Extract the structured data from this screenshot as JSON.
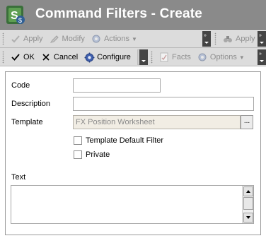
{
  "window": {
    "title": "Command Filters - Create"
  },
  "toolbar_top": {
    "apply": "Apply",
    "modify": "Modify",
    "actions": "Actions",
    "apply_right": "Apply"
  },
  "toolbar_bottom": {
    "ok": "OK",
    "cancel": "Cancel",
    "configure": "Configure",
    "facts": "Facts",
    "options": "Options"
  },
  "form": {
    "code_label": "Code",
    "code_value": "",
    "description_label": "Description",
    "description_value": "",
    "template_label": "Template",
    "template_value": "FX Position Worksheet",
    "template_browse": "...",
    "template_default_filter_label": "Template Default Filter",
    "template_default_filter_checked": false,
    "private_label": "Private",
    "private_checked": false,
    "text_label": "Text",
    "text_value": ""
  },
  "colors": {
    "titlebar": "#8a8a8a",
    "toolbar": "#dcdcdc",
    "readonly_field": "#f1ede4"
  },
  "icons": [
    "app-logo-icon",
    "apply-icon",
    "modify-icon",
    "actions-gear-icon",
    "binoculars-icon",
    "checkmark-icon",
    "close-icon",
    "configure-gear-icon",
    "facts-icon",
    "options-gear-icon"
  ]
}
